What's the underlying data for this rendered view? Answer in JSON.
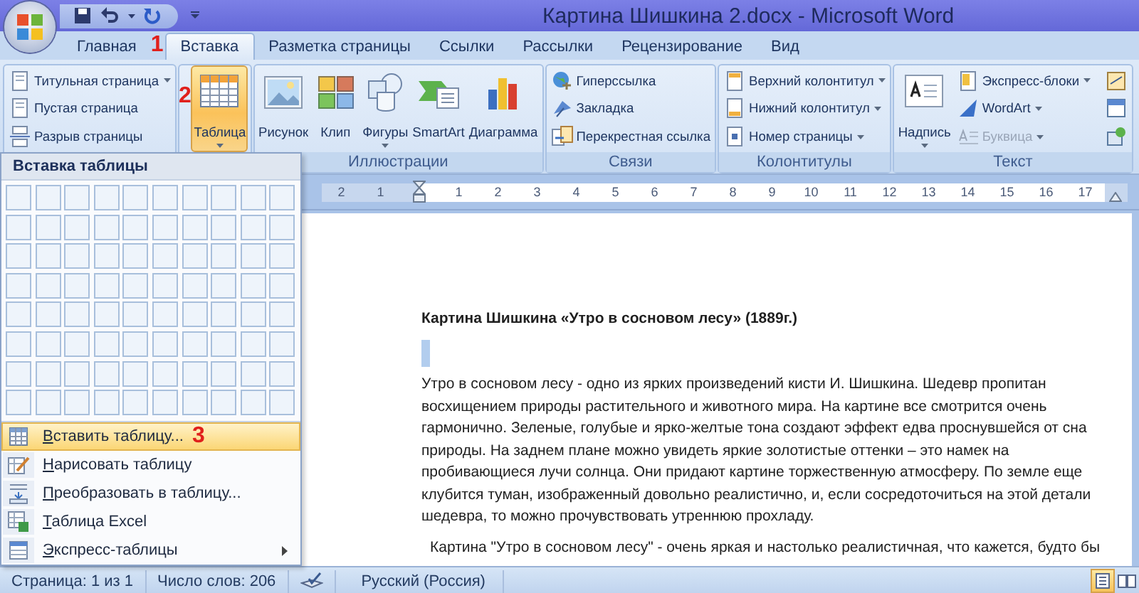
{
  "window": {
    "title": "Картина Шишкина 2.docx - Microsoft Word"
  },
  "tabs": [
    {
      "label": "Главная",
      "selected": false
    },
    {
      "label": "Вставка",
      "selected": true,
      "annotation": "1"
    },
    {
      "label": "Разметка страницы",
      "selected": false
    },
    {
      "label": "Ссылки",
      "selected": false
    },
    {
      "label": "Рассылки",
      "selected": false
    },
    {
      "label": "Рецензирование",
      "selected": false
    },
    {
      "label": "Вид",
      "selected": false
    }
  ],
  "ribbon": {
    "groups": [
      {
        "items": [
          {
            "kind": "small",
            "label": "Титульная страница",
            "dropdown": true,
            "disabled": false
          },
          {
            "kind": "small",
            "label": "Пустая страница",
            "dropdown": false,
            "disabled": false
          },
          {
            "kind": "small",
            "label": "Разрыв страницы",
            "dropdown": false,
            "disabled": false
          }
        ]
      },
      {
        "items": [
          {
            "kind": "large",
            "label": "Таблица",
            "dropdown": true,
            "pressed": true,
            "annotation": "2"
          }
        ]
      },
      {
        "label": "Иллюстрации",
        "items": [
          {
            "kind": "large",
            "label": "Рисунок",
            "dropdown": false,
            "pressed": false
          },
          {
            "kind": "large",
            "label": "Клип",
            "dropdown": false,
            "pressed": false
          },
          {
            "kind": "large",
            "label": "Фигуры",
            "dropdown": true,
            "pressed": false
          },
          {
            "kind": "large",
            "label": "SmartArt",
            "dropdown": false,
            "pressed": false
          },
          {
            "kind": "large",
            "label": "Диаграмма",
            "dropdown": false,
            "pressed": false
          }
        ]
      },
      {
        "label": "Связи",
        "items": [
          {
            "kind": "small",
            "label": "Гиперссылка",
            "dropdown": false,
            "disabled": false
          },
          {
            "kind": "small",
            "label": "Закладка",
            "dropdown": false,
            "disabled": false
          },
          {
            "kind": "small",
            "label": "Перекрестная ссылка",
            "dropdown": false,
            "disabled": false
          }
        ]
      },
      {
        "label": "Колонтитулы",
        "items": [
          {
            "kind": "small",
            "label": "Верхний колонтитул",
            "dropdown": true,
            "disabled": false
          },
          {
            "kind": "small",
            "label": "Нижний колонтитул",
            "dropdown": true,
            "disabled": false
          },
          {
            "kind": "small",
            "label": "Номер страницы",
            "dropdown": true,
            "disabled": false
          }
        ]
      },
      {
        "label": "Текст",
        "items": [
          {
            "kind": "large",
            "label": "Надпись",
            "dropdown": true,
            "pressed": false
          },
          {
            "kind": "small",
            "label": "Экспресс-блоки",
            "dropdown": true,
            "disabled": false
          },
          {
            "kind": "small",
            "label": "WordArt",
            "dropdown": true,
            "disabled": false
          },
          {
            "kind": "small",
            "label": "Буквица",
            "dropdown": true,
            "disabled": true
          }
        ]
      }
    ]
  },
  "ruler": {
    "left_marks": [
      "2",
      "1"
    ],
    "marks": [
      "1",
      "2",
      "3",
      "4",
      "5",
      "6",
      "7",
      "8",
      "9",
      "10",
      "11",
      "12",
      "13",
      "14",
      "15",
      "16",
      "17"
    ]
  },
  "document": {
    "title": "Картина Шишкина «Утро в сосновом лесу» (1889г.)",
    "paragraphs": [
      "Утро в сосновом лесу - одно из ярких произведений кисти И. Шишкина. Шедевр пропитан восхищением природы растительного и животного мира. На картине все смотрится очень гармонично. Зеленые, голубые и ярко-желтые тона создают эффект едва проснувшейся от сна природы. На заднем плане можно увидеть яркие золотистые оттенки – это намек на пробивающиеся лучи солнца. Они придают картине торжественную атмосферу. По земле еще клубится туман, изображенный довольно реалистично, и, если сосредоточиться на этой детали шедевра, то можно прочувствовать утреннюю прохладу.",
      "Картина \"Утро в сосновом лесу\" - очень яркая и настолько реалистичная, что кажется, будто бы"
    ]
  },
  "table_menu": {
    "title": "Вставка таблицы",
    "items": [
      {
        "label": "Вставить таблицу...",
        "selected": true,
        "submenu": false,
        "annotation": "3"
      },
      {
        "label": "Нарисовать таблицу",
        "selected": false,
        "submenu": false
      },
      {
        "label": "Преобразовать в таблицу...",
        "selected": false,
        "submenu": false
      },
      {
        "label": "Таблица Excel",
        "selected": false,
        "submenu": false
      },
      {
        "label": "Экспресс-таблицы",
        "selected": false,
        "submenu": true
      }
    ]
  },
  "status_bar": {
    "page": "Страница: 1 из 1",
    "words": "Число слов: 206",
    "language": "Русский (Россия)",
    "views": [
      {
        "selected": true
      },
      {
        "selected": false
      }
    ]
  }
}
